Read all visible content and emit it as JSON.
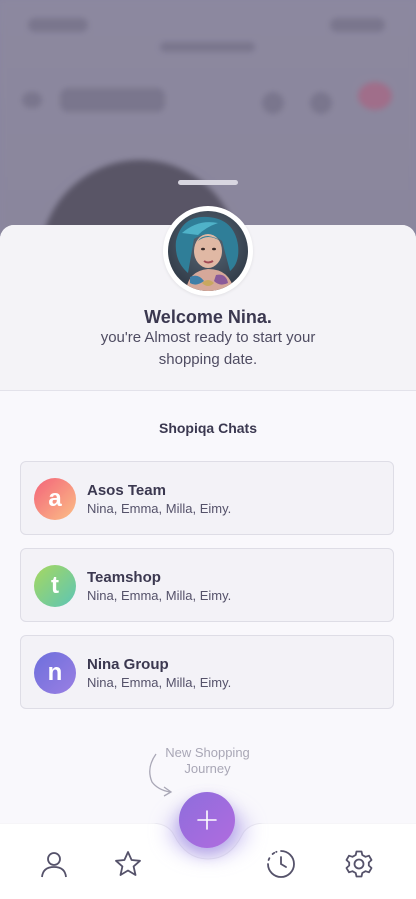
{
  "profile": {
    "welcome": "Welcome Nina.",
    "subtitle": "you're Almost ready to start your shopping date."
  },
  "chats_section": {
    "title": "Shopiqa Chats",
    "items": [
      {
        "initial": "a",
        "name": "Asos Team",
        "members": "Nina, Emma, Milla, Eimy.",
        "color_from": "#f3637a",
        "color_to": "#fbbf86"
      },
      {
        "initial": "t",
        "name": "Teamshop",
        "members": "Nina, Emma, Milla, Eimy.",
        "color_from": "#a7d85f",
        "color_to": "#5cc5b6"
      },
      {
        "initial": "n",
        "name": "Nina Group",
        "members": "Nina, Emma, Milla, Eimy.",
        "color_from": "#6d6fdc",
        "color_to": "#9a7fe3"
      }
    ]
  },
  "hint": {
    "line1": "New Shopping",
    "line2": "Journey"
  },
  "fab": {
    "icon": "plus-icon"
  },
  "nav": {
    "items": [
      {
        "icon": "user-icon"
      },
      {
        "icon": "star-icon"
      },
      {
        "icon": "history-icon"
      },
      {
        "icon": "settings-icon"
      }
    ]
  },
  "colors": {
    "accent": "#9b6ddd",
    "text": "#3b3850",
    "muted": "#a9a7b6"
  }
}
